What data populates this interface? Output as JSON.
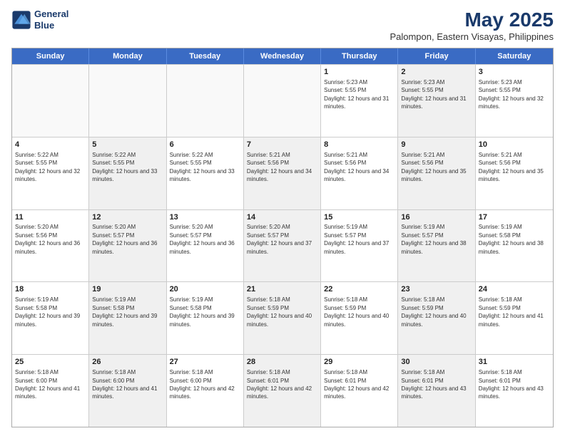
{
  "logo": {
    "line1": "General",
    "line2": "Blue"
  },
  "title": "May 2025",
  "subtitle": "Palompon, Eastern Visayas, Philippines",
  "weekdays": [
    "Sunday",
    "Monday",
    "Tuesday",
    "Wednesday",
    "Thursday",
    "Friday",
    "Saturday"
  ],
  "weeks": [
    [
      {
        "day": "",
        "empty": true
      },
      {
        "day": "",
        "empty": true
      },
      {
        "day": "",
        "empty": true
      },
      {
        "day": "",
        "empty": true
      },
      {
        "day": "1",
        "sunrise": "5:23 AM",
        "sunset": "5:55 PM",
        "daylight": "12 hours and 31 minutes."
      },
      {
        "day": "2",
        "sunrise": "5:23 AM",
        "sunset": "5:55 PM",
        "daylight": "12 hours and 31 minutes.",
        "shaded": true
      },
      {
        "day": "3",
        "sunrise": "5:23 AM",
        "sunset": "5:55 PM",
        "daylight": "12 hours and 32 minutes."
      }
    ],
    [
      {
        "day": "4",
        "sunrise": "5:22 AM",
        "sunset": "5:55 PM",
        "daylight": "12 hours and 32 minutes."
      },
      {
        "day": "5",
        "sunrise": "5:22 AM",
        "sunset": "5:55 PM",
        "daylight": "12 hours and 33 minutes.",
        "shaded": true
      },
      {
        "day": "6",
        "sunrise": "5:22 AM",
        "sunset": "5:55 PM",
        "daylight": "12 hours and 33 minutes."
      },
      {
        "day": "7",
        "sunrise": "5:21 AM",
        "sunset": "5:56 PM",
        "daylight": "12 hours and 34 minutes.",
        "shaded": true
      },
      {
        "day": "8",
        "sunrise": "5:21 AM",
        "sunset": "5:56 PM",
        "daylight": "12 hours and 34 minutes."
      },
      {
        "day": "9",
        "sunrise": "5:21 AM",
        "sunset": "5:56 PM",
        "daylight": "12 hours and 35 minutes.",
        "shaded": true
      },
      {
        "day": "10",
        "sunrise": "5:21 AM",
        "sunset": "5:56 PM",
        "daylight": "12 hours and 35 minutes."
      }
    ],
    [
      {
        "day": "11",
        "sunrise": "5:20 AM",
        "sunset": "5:56 PM",
        "daylight": "12 hours and 36 minutes."
      },
      {
        "day": "12",
        "sunrise": "5:20 AM",
        "sunset": "5:57 PM",
        "daylight": "12 hours and 36 minutes.",
        "shaded": true
      },
      {
        "day": "13",
        "sunrise": "5:20 AM",
        "sunset": "5:57 PM",
        "daylight": "12 hours and 36 minutes."
      },
      {
        "day": "14",
        "sunrise": "5:20 AM",
        "sunset": "5:57 PM",
        "daylight": "12 hours and 37 minutes.",
        "shaded": true
      },
      {
        "day": "15",
        "sunrise": "5:19 AM",
        "sunset": "5:57 PM",
        "daylight": "12 hours and 37 minutes."
      },
      {
        "day": "16",
        "sunrise": "5:19 AM",
        "sunset": "5:57 PM",
        "daylight": "12 hours and 38 minutes.",
        "shaded": true
      },
      {
        "day": "17",
        "sunrise": "5:19 AM",
        "sunset": "5:58 PM",
        "daylight": "12 hours and 38 minutes."
      }
    ],
    [
      {
        "day": "18",
        "sunrise": "5:19 AM",
        "sunset": "5:58 PM",
        "daylight": "12 hours and 39 minutes."
      },
      {
        "day": "19",
        "sunrise": "5:19 AM",
        "sunset": "5:58 PM",
        "daylight": "12 hours and 39 minutes.",
        "shaded": true
      },
      {
        "day": "20",
        "sunrise": "5:19 AM",
        "sunset": "5:58 PM",
        "daylight": "12 hours and 39 minutes."
      },
      {
        "day": "21",
        "sunrise": "5:18 AM",
        "sunset": "5:59 PM",
        "daylight": "12 hours and 40 minutes.",
        "shaded": true
      },
      {
        "day": "22",
        "sunrise": "5:18 AM",
        "sunset": "5:59 PM",
        "daylight": "12 hours and 40 minutes."
      },
      {
        "day": "23",
        "sunrise": "5:18 AM",
        "sunset": "5:59 PM",
        "daylight": "12 hours and 40 minutes.",
        "shaded": true
      },
      {
        "day": "24",
        "sunrise": "5:18 AM",
        "sunset": "5:59 PM",
        "daylight": "12 hours and 41 minutes."
      }
    ],
    [
      {
        "day": "25",
        "sunrise": "5:18 AM",
        "sunset": "6:00 PM",
        "daylight": "12 hours and 41 minutes."
      },
      {
        "day": "26",
        "sunrise": "5:18 AM",
        "sunset": "6:00 PM",
        "daylight": "12 hours and 41 minutes.",
        "shaded": true
      },
      {
        "day": "27",
        "sunrise": "5:18 AM",
        "sunset": "6:00 PM",
        "daylight": "12 hours and 42 minutes."
      },
      {
        "day": "28",
        "sunrise": "5:18 AM",
        "sunset": "6:01 PM",
        "daylight": "12 hours and 42 minutes.",
        "shaded": true
      },
      {
        "day": "29",
        "sunrise": "5:18 AM",
        "sunset": "6:01 PM",
        "daylight": "12 hours and 42 minutes."
      },
      {
        "day": "30",
        "sunrise": "5:18 AM",
        "sunset": "6:01 PM",
        "daylight": "12 hours and 43 minutes.",
        "shaded": true
      },
      {
        "day": "31",
        "sunrise": "5:18 AM",
        "sunset": "6:01 PM",
        "daylight": "12 hours and 43 minutes."
      }
    ]
  ]
}
